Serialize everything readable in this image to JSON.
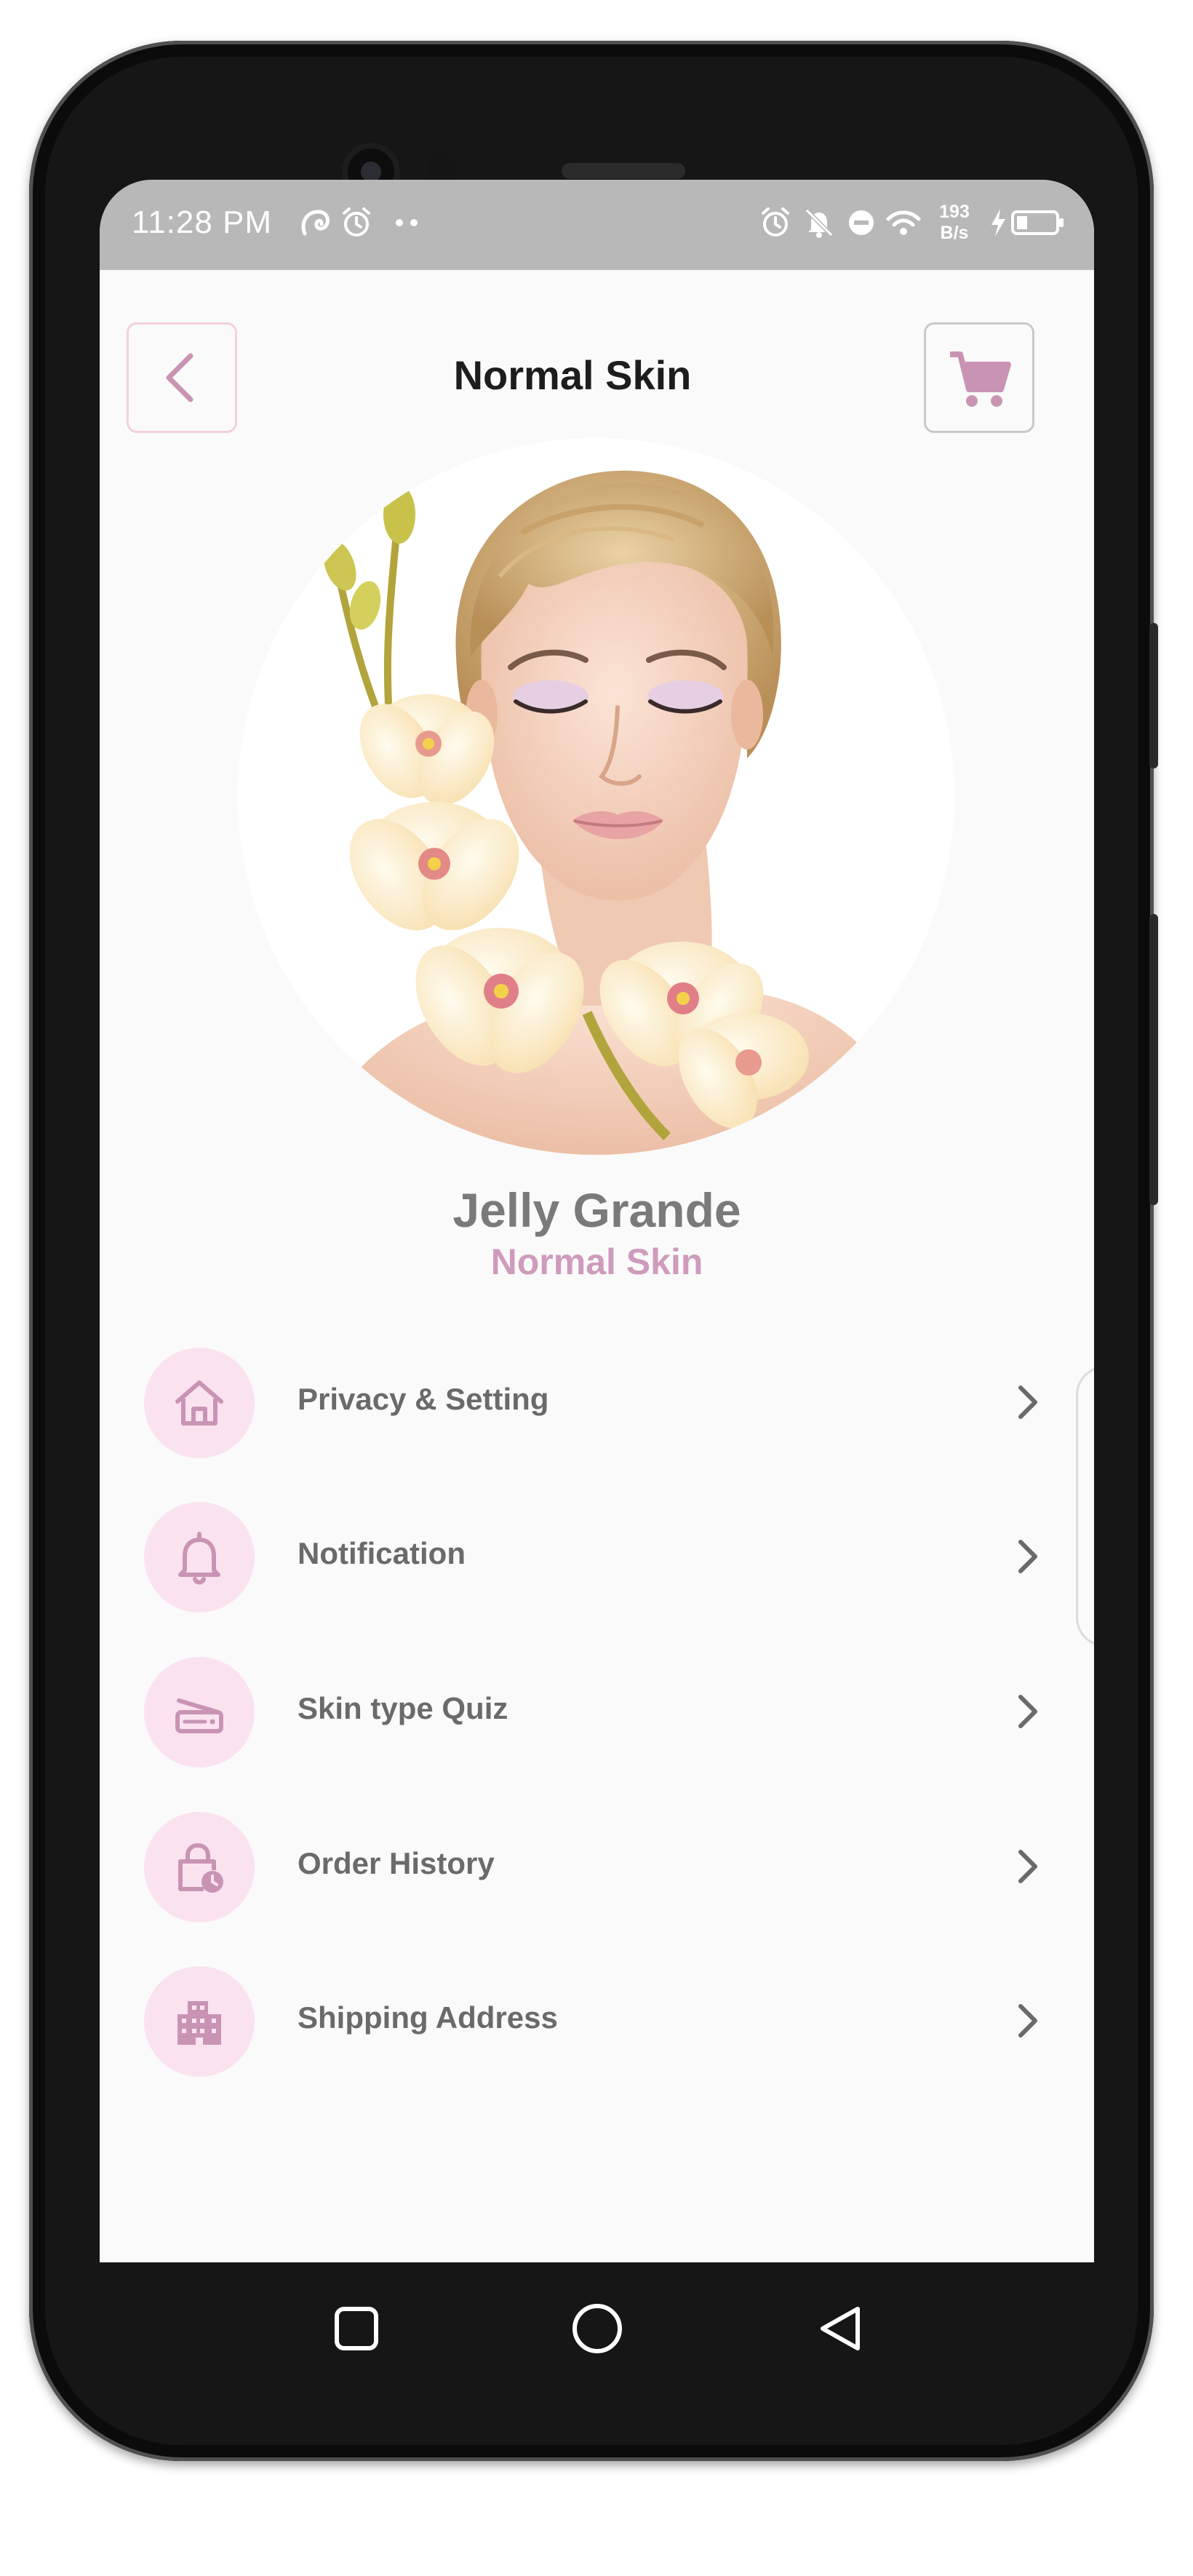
{
  "status_bar": {
    "time": "11:28 PM",
    "net_speed_value": "193",
    "net_speed_unit": "B/s",
    "left_icons": [
      "hotspot-icon",
      "alarm-icon",
      "more-dots-icon"
    ],
    "right_icons": [
      "alarm-icon",
      "mute-icon",
      "dnd-icon",
      "wifi-icon",
      "charging-icon",
      "battery-icon"
    ]
  },
  "header": {
    "title": "Normal Skin",
    "back_icon": "chevron-left-icon",
    "cart_icon": "cart-icon"
  },
  "profile": {
    "name": "Jelly Grande",
    "skin_type": "Normal Skin",
    "photo": "woman-with-orchids-photo"
  },
  "menu": {
    "items": [
      {
        "label": "Privacy & Setting",
        "icon": "home-icon"
      },
      {
        "label": "Notification",
        "icon": "bell-icon"
      },
      {
        "label": "Skin type Quiz",
        "icon": "scanner-icon"
      },
      {
        "label": "Order History",
        "icon": "lock-clock-icon"
      },
      {
        "label": "Shipping Address",
        "icon": "building-icon"
      }
    ]
  },
  "navigation": {
    "buttons": [
      "recents-icon",
      "home-icon",
      "back-icon"
    ]
  },
  "colors": {
    "accent_pink": "#cf9bbb",
    "icon_bg": "#fae3ef",
    "icon_fg": "#c994b3",
    "status_bar": "#b8b8b8"
  }
}
